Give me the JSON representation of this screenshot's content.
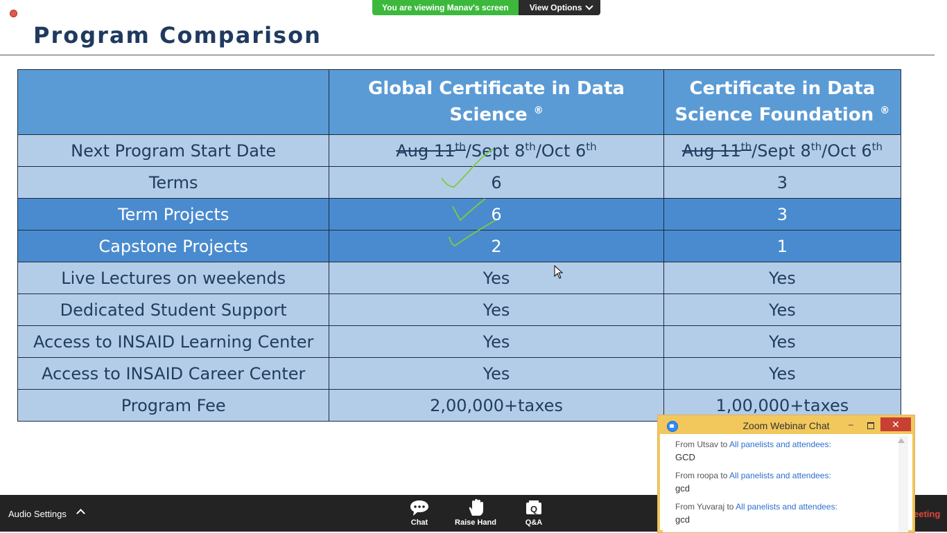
{
  "banner": {
    "viewing_text": "You are viewing Manav's screen",
    "view_options": "View Options"
  },
  "slide": {
    "title": "Program Comparison",
    "headers": [
      "",
      "Global Certificate in Data Science",
      "Certificate in Data Science Foundation"
    ],
    "registered_mark": "®",
    "start_date": {
      "label": "Next Program Start Date",
      "struck": "Aug 11",
      "sup_th": "th",
      "sept": "/Sept 8",
      "oct": "/Oct 6"
    },
    "rows": [
      {
        "label": "Terms",
        "gcds": "6",
        "cdsf": "3",
        "style": "light"
      },
      {
        "label": "Term Projects",
        "gcds": "6",
        "cdsf": "3",
        "style": "dark"
      },
      {
        "label": "Capstone Projects",
        "gcds": "2",
        "cdsf": "1",
        "style": "dark"
      },
      {
        "label": "Live Lectures on weekends",
        "gcds": "Yes",
        "cdsf": "Yes",
        "style": "light"
      },
      {
        "label": "Dedicated Student Support",
        "gcds": "Yes",
        "cdsf": "Yes",
        "style": "light"
      },
      {
        "label": "Access to INSAID Learning Center",
        "gcds": "Yes",
        "cdsf": "Yes",
        "style": "light"
      },
      {
        "label": "Access to INSAID Career Center",
        "gcds": "Yes",
        "cdsf": "Yes",
        "style": "light"
      },
      {
        "label": "Program Fee",
        "gcds": "2,00,000+taxes",
        "cdsf": "1,00,000+taxes",
        "style": "light"
      }
    ]
  },
  "toolbar": {
    "audio_settings": "Audio Settings",
    "chat": "Chat",
    "raise_hand": "Raise Hand",
    "qa": "Q&A",
    "end_meeting_partial": "eeting",
    "qa_icon_letter": "Q"
  },
  "chat_window": {
    "title": "Zoom Webinar Chat",
    "min_glyph": "–",
    "close_glyph": "✕",
    "messages": [
      {
        "from": "From Utsav to ",
        "to": "All panelists and attendees:",
        "text": "GCD"
      },
      {
        "from": "From roopa to ",
        "to": "All panelists and attendees:",
        "text": "gcd"
      },
      {
        "from": "From Yuvaraj to ",
        "to": "All panelists and attendees:",
        "text": "gcd"
      }
    ]
  },
  "colors": {
    "header_blue": "#5b9bd5",
    "light_row": "#b3cde9",
    "dark_row": "#4a8bcf",
    "check_green": "#7ecb3c",
    "zoom_green": "#3cb93c"
  }
}
